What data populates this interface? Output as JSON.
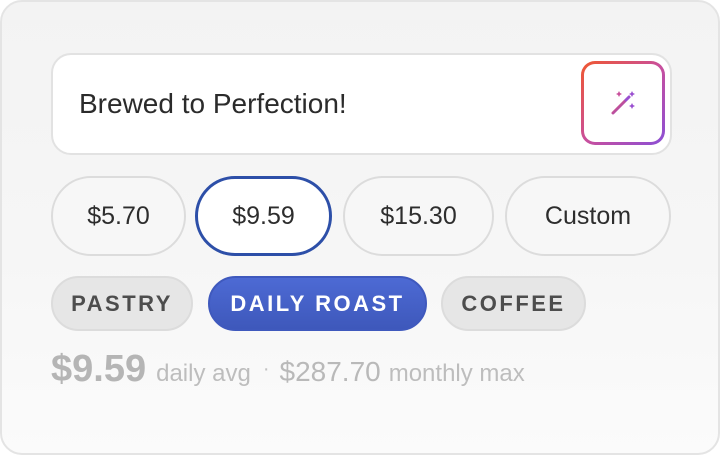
{
  "message": {
    "text": "Brewed to Perfection!",
    "magic_button_icon": "magic-wand-icon"
  },
  "price_options": [
    {
      "label": "$5.70",
      "selected": false
    },
    {
      "label": "$9.59",
      "selected": true
    },
    {
      "label": "$15.30",
      "selected": false
    },
    {
      "label": "Custom",
      "selected": false
    }
  ],
  "categories": [
    {
      "label": "PASTRY",
      "active": false
    },
    {
      "label": "DAILY ROAST",
      "active": true
    },
    {
      "label": "COFFEE",
      "active": false
    }
  ],
  "summary": {
    "daily_amount": "$9.59",
    "daily_label": "daily avg",
    "separator": "·",
    "monthly_amount": "$287.70",
    "monthly_label": "monthly max"
  },
  "colors": {
    "selected_border": "#2d4fa8",
    "active_tag": "#4760c8",
    "magic_gradient_start": "#f0572e",
    "magic_gradient_end": "#8a4fd6"
  }
}
